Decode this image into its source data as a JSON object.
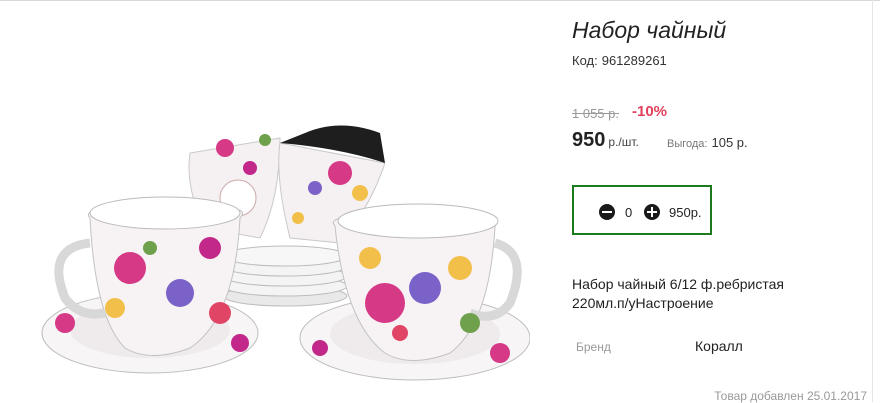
{
  "product": {
    "title": "Набор чайный",
    "code_label": "Код:",
    "code": "961289261",
    "old_price": "1 055 р.",
    "discount": "-10%",
    "price": "950",
    "price_unit": "р./шт.",
    "savings_label": "Выгода:",
    "savings_value": "105 р.",
    "description": "Набор чайный 6/12 ф.ребристая 220мл.п/уНастроение",
    "brand_label": "Бренд",
    "brand_value": "Коралл",
    "added_date": "Товар добавлен 25.01.2017"
  },
  "cart": {
    "quantity": "0",
    "total": "950р."
  },
  "icons": {
    "minus": "minus-circle-icon",
    "plus": "plus-circle-icon"
  },
  "colors": {
    "discount": "#e2405b",
    "qty_border": "#1c7a1c"
  }
}
